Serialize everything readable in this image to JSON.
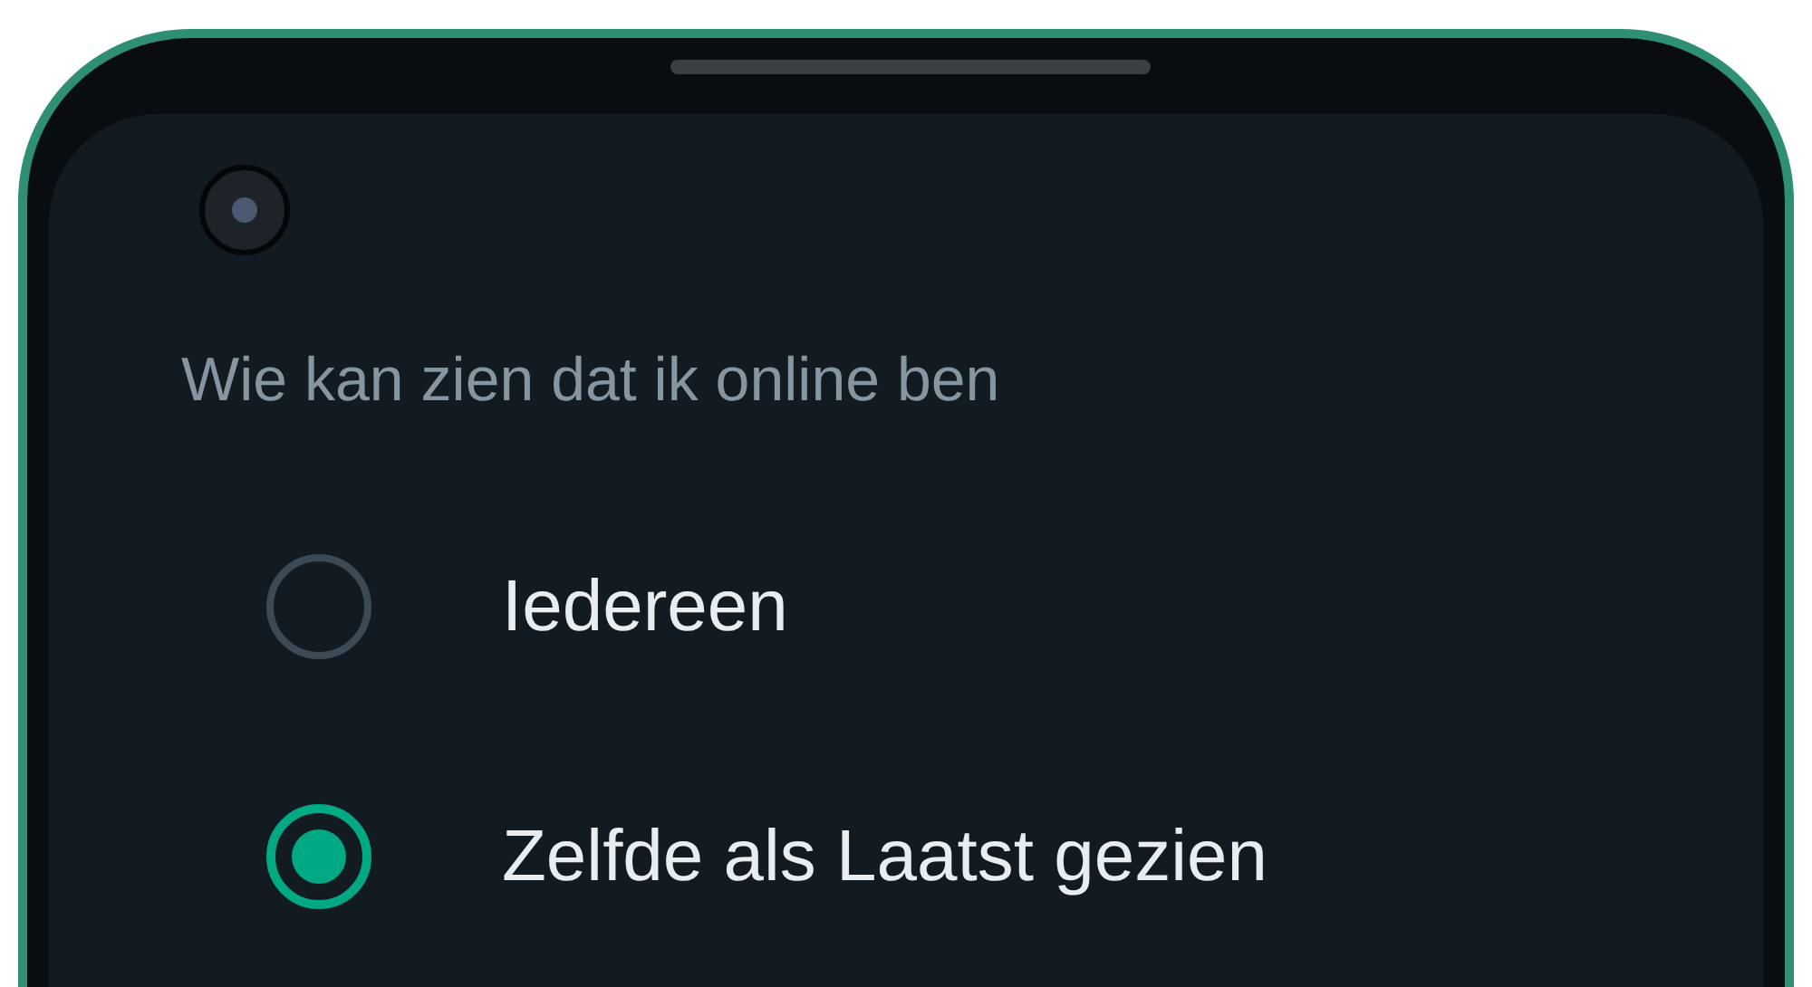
{
  "section_title": "Wie kan zien dat ik online ben",
  "options": [
    {
      "label": "Iedereen",
      "selected": false
    },
    {
      "label": "Zelfde als Laatst gezien",
      "selected": true
    }
  ]
}
